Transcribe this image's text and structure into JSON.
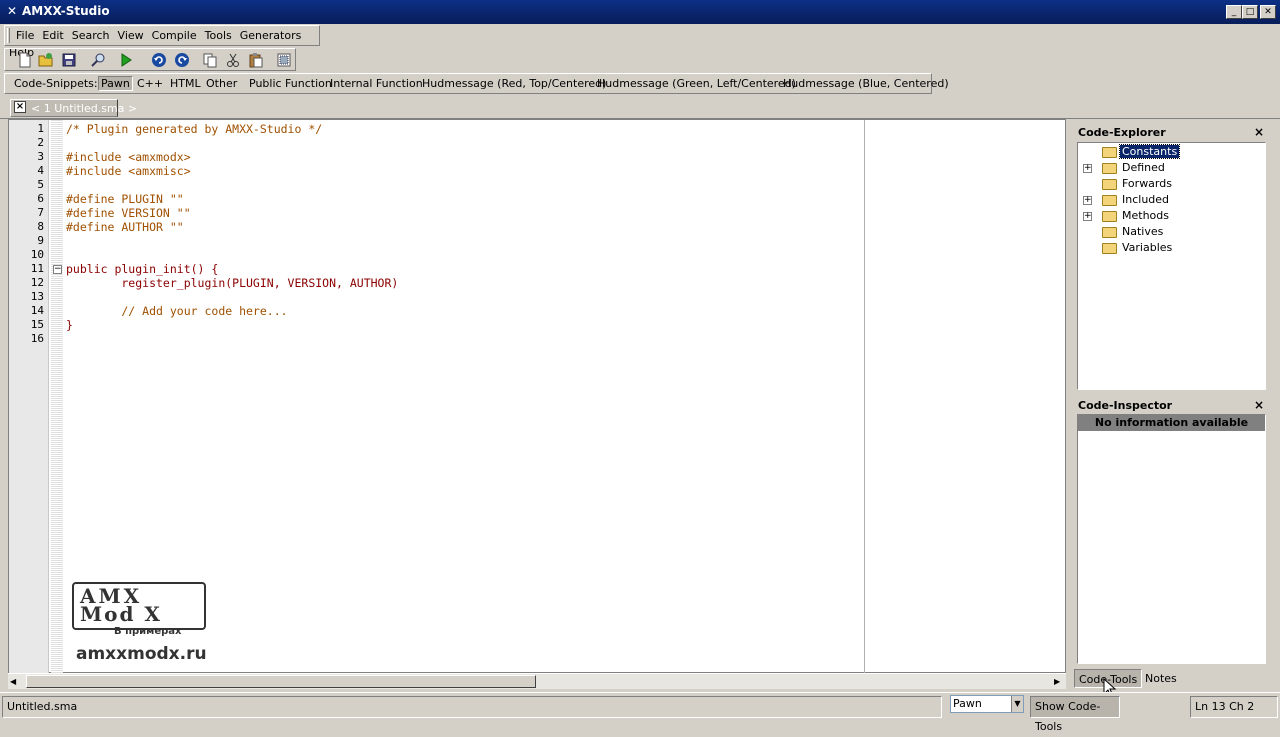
{
  "window": {
    "title": "AMXX-Studio",
    "icon": "amxx-x-icon"
  },
  "menu": [
    "File",
    "Edit",
    "Search",
    "View",
    "Compile",
    "Tools",
    "Generators",
    "Help"
  ],
  "toolbar": [
    "new-file-icon",
    "open-folder-icon",
    "save-icon",
    "find-icon",
    "compile-run-icon",
    "undo-icon",
    "redo-icon",
    "copy-icon",
    "cut-icon",
    "paste-icon",
    "select-all-icon"
  ],
  "snippets": {
    "label": "Code-Snippets:",
    "items": [
      "Pawn",
      "C++",
      "HTML",
      "Other",
      "Public Function",
      "Internal Function",
      "Hudmessage (Red, Top/Centered)",
      "Hudmessage (Green, Left/Centered)",
      "Hudmessage (Blue, Centered)"
    ],
    "active": "Pawn"
  },
  "document_tab": {
    "label": "< 1 Untitled.sma >"
  },
  "editor": {
    "lines": [
      {
        "n": "1",
        "text": "/* Plugin generated by AMXX-Studio */",
        "color": "#a05000"
      },
      {
        "n": "2",
        "text": "",
        "color": "#000000"
      },
      {
        "n": "3",
        "text": "#include <amxmodx>",
        "color": "#a05000"
      },
      {
        "n": "4",
        "text": "#include <amxmisc>",
        "color": "#a05000"
      },
      {
        "n": "5",
        "text": "",
        "color": "#000000"
      },
      {
        "n": "6",
        "text": "#define PLUGIN \"\"",
        "color": "#a05000"
      },
      {
        "n": "7",
        "text": "#define VERSION \"\"",
        "color": "#a05000"
      },
      {
        "n": "8",
        "text": "#define AUTHOR \"\"",
        "color": "#a05000"
      },
      {
        "n": "9",
        "text": "",
        "color": "#000000"
      },
      {
        "n": "10",
        "text": "",
        "color": "#000000"
      },
      {
        "n": "11",
        "text": "public plugin_init() {",
        "color": "#8b0000"
      },
      {
        "n": "12",
        "text": "        register_plugin(PLUGIN, VERSION, AUTHOR)",
        "color": "#8b0000"
      },
      {
        "n": "13",
        "text": "",
        "color": "#000000"
      },
      {
        "n": "14",
        "text": "        // Add your code here...",
        "color": "#a05000"
      },
      {
        "n": "15",
        "text": "}",
        "color": "#8b0000"
      },
      {
        "n": "16",
        "text": "",
        "color": "#000000"
      }
    ]
  },
  "code_explorer": {
    "title": "Code-Explorer",
    "close": "×",
    "nodes": [
      {
        "label": "Constants",
        "expandable": false,
        "selected": true
      },
      {
        "label": "Defined",
        "expandable": true,
        "selected": false
      },
      {
        "label": "Forwards",
        "expandable": false,
        "selected": false
      },
      {
        "label": "Included",
        "expandable": true,
        "selected": false
      },
      {
        "label": "Methods",
        "expandable": true,
        "selected": false
      },
      {
        "label": "Natives",
        "expandable": false,
        "selected": false
      },
      {
        "label": "Variables",
        "expandable": false,
        "selected": false
      }
    ]
  },
  "code_inspector": {
    "title": "Code-Inspector",
    "close": "×",
    "message": "No information available"
  },
  "bottom_tabs": [
    "Code-Tools",
    "Notes"
  ],
  "status": {
    "file": "Untitled.sma",
    "language": "Pawn",
    "show_tools": "Show Code-Tools",
    "position": "Ln 13 Ch 2"
  },
  "watermark": {
    "logo_line1": "AMX",
    "logo_line2": "Mod X",
    "logo_sub": "В примерах",
    "site": "amxxmodx.ru"
  }
}
